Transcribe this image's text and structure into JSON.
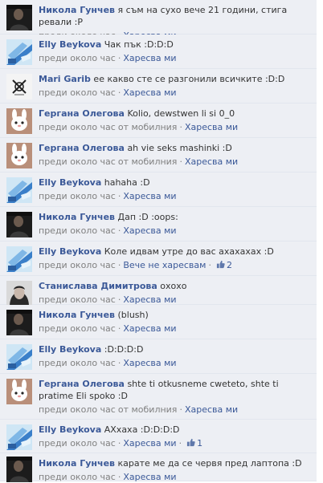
{
  "comments": [
    {
      "author": "Никола Гунчев",
      "text": "я съм на сухо вече 21 години, стига ревали :P",
      "time": "преди около час",
      "mobile": "",
      "action": "Харесва ми",
      "likes": "",
      "avatar": "avatar-male-dark"
    },
    {
      "author": "Elly Beykova",
      "text": "Чак пък :D:D:D",
      "time": "преди около час",
      "mobile": "",
      "action": "Харесва ми",
      "likes": "",
      "avatar": "avatar-blue-shoes"
    },
    {
      "author": "Mari Garib",
      "text": "ее какво сте се разгонили всичките :D:D",
      "time": "преди около час",
      "mobile": "",
      "action": "Харесва ми",
      "likes": "",
      "avatar": "avatar-sketch"
    },
    {
      "author": "Гергана Олегова",
      "text": "Kolio, dewstwen li si 0_0",
      "time": "преди около час",
      "mobile": "от мобилния",
      "action": "Харесва ми",
      "likes": "",
      "avatar": "avatar-bunny"
    },
    {
      "author": "Гергана Олегова",
      "text": "ah vie seks mashinki :D",
      "time": "преди около час",
      "mobile": "от мобилния",
      "action": "Харесва ми",
      "likes": "",
      "avatar": "avatar-bunny"
    },
    {
      "author": "Elly Beykova",
      "text": "hahaha :D",
      "time": "преди около час",
      "mobile": "",
      "action": "Харесва ми",
      "likes": "",
      "avatar": "avatar-blue-shoes"
    },
    {
      "author": "Никола Гунчев",
      "text": "Дап :D :oops:",
      "time": "преди около час",
      "mobile": "",
      "action": "Харесва ми",
      "likes": "",
      "avatar": "avatar-male-dark"
    },
    {
      "author": "Elly Beykova",
      "text": "Коле идвам утре до вас ахахахах :D",
      "time": "преди около час",
      "mobile": "",
      "action": "Вече не харесвам",
      "likes": "2",
      "avatar": "avatar-blue-shoes"
    },
    {
      "author": "Станислава Димитрова",
      "text": "охохо",
      "time": "преди около час",
      "mobile": "",
      "action": "Харесва ми",
      "likes": "",
      "avatar": "avatar-female"
    },
    {
      "author": "Никола Гунчев",
      "text": "(blush)",
      "time": "преди около час",
      "mobile": "",
      "action": "Харесва ми",
      "likes": "",
      "avatar": "avatar-male-dark"
    },
    {
      "author": "Elly Beykova",
      "text": ":D:D:D:D",
      "time": "преди около час",
      "mobile": "",
      "action": "Харесва ми",
      "likes": "",
      "avatar": "avatar-blue-shoes"
    },
    {
      "author": "Гергана Олегова",
      "text": "shte ti otkusneme cweteto, shte ti pratime Eli spoko :D",
      "time": "преди около час",
      "mobile": "от мобилния",
      "action": "Харесва ми",
      "likes": "",
      "avatar": "avatar-bunny"
    },
    {
      "author": "Elly Beykova",
      "text": "АХхаха :D:D:D:D",
      "time": "преди около час",
      "mobile": "",
      "action": "Харесва ми",
      "likes": "1",
      "avatar": "avatar-blue-shoes"
    },
    {
      "author": "Никола Гунчев",
      "text": "карате ме да се червя пред лаптопа :D",
      "time": "преди около час",
      "mobile": "",
      "action": "Харесва ми",
      "likes": "",
      "avatar": "avatar-male-dark"
    }
  ],
  "separator": "·",
  "thumb_icon": "thumbs-up-icon",
  "colors": {
    "background": "#edeff4",
    "link": "#3b5998",
    "meta": "#808080"
  }
}
